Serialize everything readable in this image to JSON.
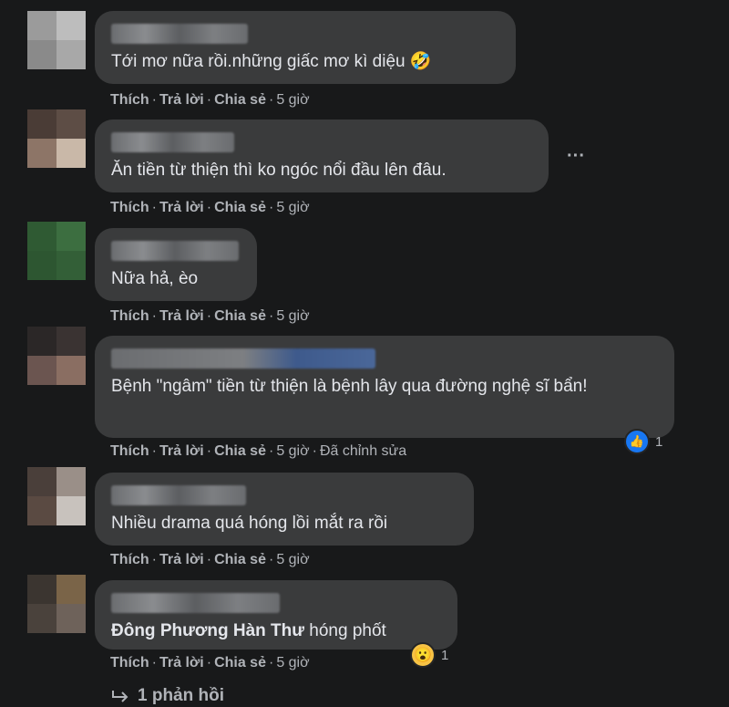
{
  "actions": {
    "like": "Thích",
    "reply": "Trả lời",
    "share": "Chia sẻ",
    "separator": "·"
  },
  "comments": [
    {
      "text": "Tới mơ nữa rồi.những giấc mơ kì diệu",
      "emoji": "🤣",
      "time": "5 giờ"
    },
    {
      "text": "Ăn tiền từ thiện thì ko ngóc nổi đầu lên đâu.",
      "time": "5 giờ",
      "more": "···"
    },
    {
      "text": "Nữa hả, èo",
      "time": "5 giờ"
    },
    {
      "text": "Bệnh \"ngâm\" tiền từ thiện là bệnh lây qua đường nghệ sĩ bẩn!",
      "time": "5 giờ",
      "edited": "Đã chỉnh sửa",
      "reaction_icon": "like-icon",
      "reaction_count": "1"
    },
    {
      "text": "Nhiều drama quá hóng lồi mắt ra rồi",
      "time": "5 giờ"
    },
    {
      "tag": "Đông Phương Hàn Thư",
      "text": "hóng phốt",
      "time": "5 giờ",
      "reaction_icon": "wow-icon",
      "reaction_count": "1"
    }
  ],
  "replies_label": "1 phản hồi",
  "colors": {
    "background": "#18191a",
    "bubble": "#3a3b3c",
    "text": "#e4e6eb",
    "secondary": "#b0b3b8",
    "like_blue": "#1877f2"
  }
}
